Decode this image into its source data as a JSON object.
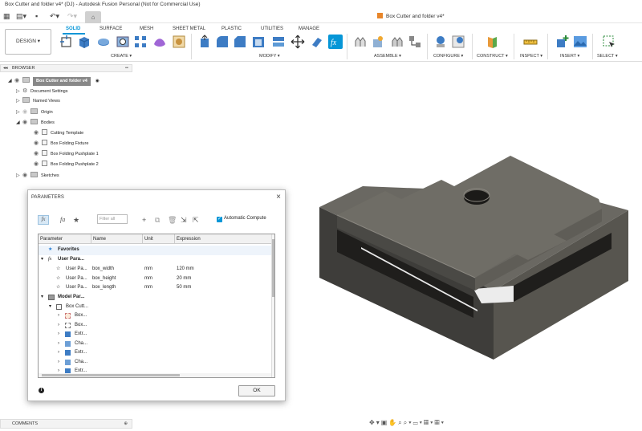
{
  "window": {
    "title": "Box Cutter and folder v4* (DJ) - Autodesk Fusion Personal (Not for Commercial Use)"
  },
  "document_tab": {
    "title": "Box Cutter and folder v4*"
  },
  "toolbar": {
    "workspace_button": "DESIGN ▾",
    "tabs": [
      "SOLID",
      "SURFACE",
      "MESH",
      "SHEET METAL",
      "PLASTIC",
      "UTILITIES",
      "MANAGE"
    ],
    "active_tab": "SOLID",
    "groups": [
      "CREATE ▾",
      "MODIFY ▾",
      "ASSEMBLE ▾",
      "CONFIGURE ▾",
      "CONSTRUCT ▾",
      "INSPECT ▾",
      "INSERT ▾",
      "SELECT ▾"
    ]
  },
  "browser": {
    "header": "BROWSER",
    "root": "Box Cutter and folder v4",
    "items": [
      "Document Settings",
      "Named Views",
      "Origin",
      "Bodies"
    ],
    "bodies": [
      "Cutting Template",
      "Box Folding Fixture",
      "Box Folding Pushplate 1",
      "Box Folding Pushplate 2"
    ],
    "last": "Sketches"
  },
  "parameters": {
    "title": "PARAMETERS",
    "filter_placeholder": "Filter all",
    "auto_compute_label": "Automatic Compute",
    "ok_label": "OK",
    "columns": [
      "Parameter",
      "Name",
      "Unit",
      "Expression"
    ],
    "favorites_label": "Favorites",
    "user_group_label": "User Para...",
    "user_params": [
      {
        "param": "User Pa...",
        "name": "box_width",
        "unit": "mm",
        "expr": "120 mm"
      },
      {
        "param": "User Pa...",
        "name": "box_height",
        "unit": "mm",
        "expr": "20 mm"
      },
      {
        "param": "User Pa...",
        "name": "box_length",
        "unit": "mm",
        "expr": "50 mm"
      }
    ],
    "model_group_label": "Model Par...",
    "model_component": "Box Cutt...",
    "model_features": [
      "Box...",
      "Box...",
      "Extr...",
      "Cha...",
      "Extr...",
      "Cha...",
      "Extr..."
    ]
  },
  "comments": {
    "label": "COMMENTS"
  },
  "colors": {
    "accent": "#0696d7",
    "model": "#5c5a55"
  }
}
